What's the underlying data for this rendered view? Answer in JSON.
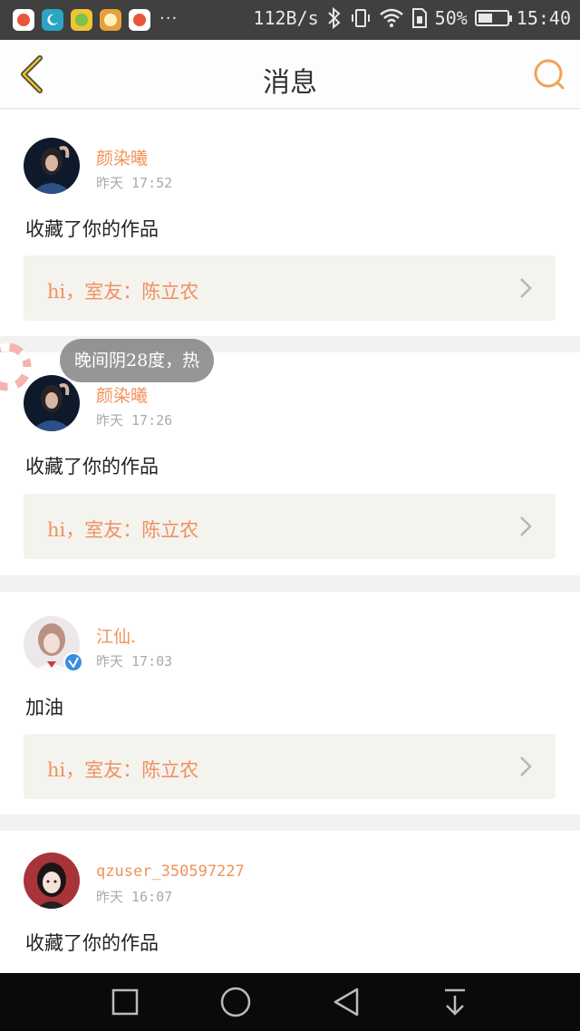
{
  "status_bar": {
    "apps": [
      {
        "icon": "app-icon-1",
        "color": "#e8563b"
      },
      {
        "icon": "moon-app-icon",
        "color": "#2aa6c4"
      },
      {
        "icon": "app-icon-3",
        "color": "#f2c434"
      },
      {
        "icon": "app-icon-4",
        "color": "#e8a03a"
      },
      {
        "icon": "app-icon-5",
        "color": "#e8563b"
      }
    ],
    "more": "···",
    "net_speed": "112B/s",
    "battery_percent": "50%",
    "battery_level": 0.5,
    "time": "15:40"
  },
  "header": {
    "title": "消息",
    "back_icon": "chevron-left-icon",
    "search_icon": "search-icon",
    "accent_color": "#f0a25a"
  },
  "messages": [
    {
      "username": "颜染曦",
      "time": "昨天 17:52",
      "text": "收藏了你的作品",
      "quote": "hi，室友：陈立农"
    },
    {
      "username": "颜染曦",
      "time": "昨天 17:26",
      "text": "收藏了你的作品",
      "quote": "hi，室友：陈立农"
    },
    {
      "username": "江仙.",
      "time": "昨天 17:03",
      "text": "加油",
      "quote": "hi，室友：陈立农",
      "verified": true
    },
    {
      "username": "qzuser_350597227",
      "time": "昨天 16:07",
      "text": "收藏了你的作品"
    }
  ],
  "toast": {
    "text": "晚间阴28度，热"
  },
  "colors": {
    "username": "#f0925a",
    "quote_bg": "#f4f3ee"
  }
}
